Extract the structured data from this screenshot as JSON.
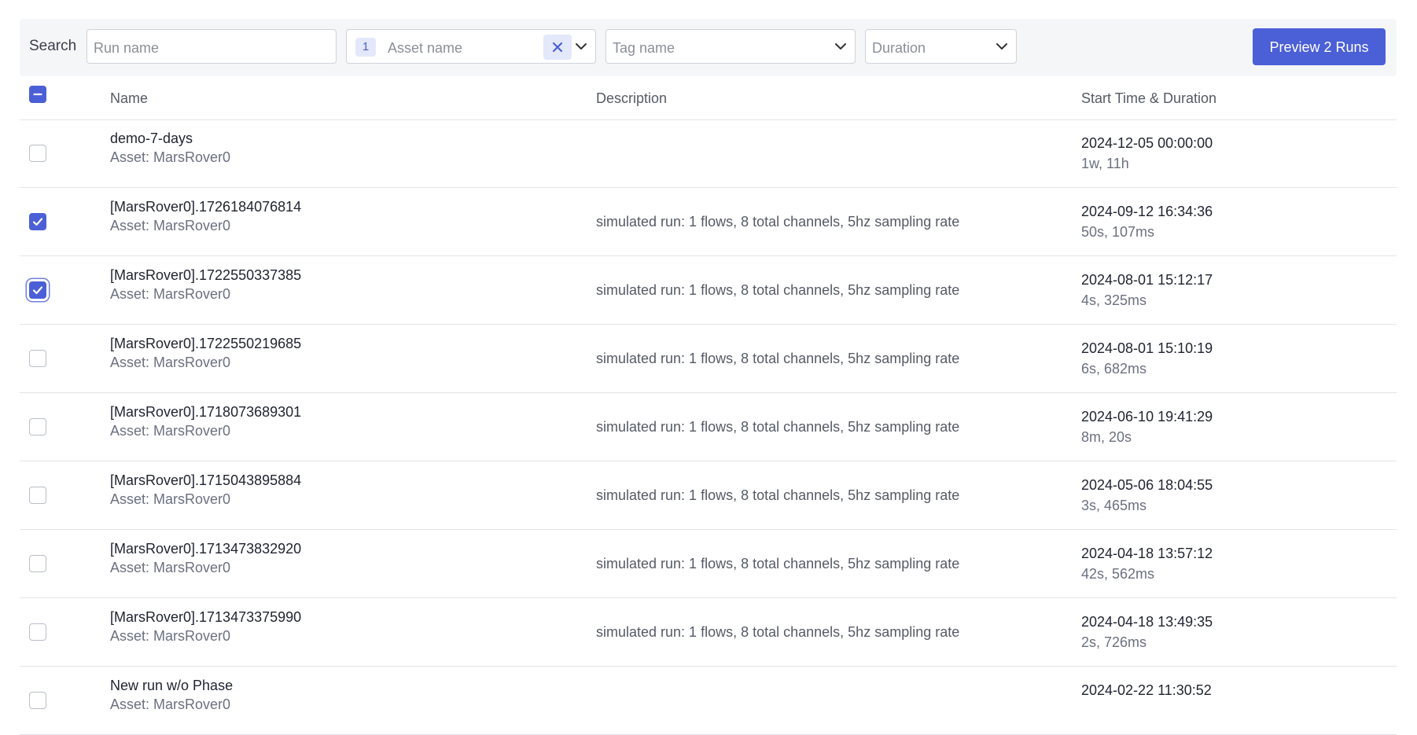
{
  "toolbar": {
    "search_label": "Search",
    "run_name_placeholder": "Run name",
    "asset_count": "1",
    "asset_placeholder": "Asset name",
    "tag_placeholder": "Tag name",
    "duration_placeholder": "Duration",
    "preview_label": "Preview 2 Runs"
  },
  "table": {
    "headers": {
      "name": "Name",
      "description": "Description",
      "start": "Start Time & Duration"
    },
    "select_all_state": "indeterminate",
    "rows": [
      {
        "name": "demo-7-days",
        "asset": "Asset: MarsRover0",
        "description": "",
        "start": "2024-12-05 00:00:00",
        "duration": "1w, 11h",
        "checked": false
      },
      {
        "name": "[MarsRover0].1726184076814",
        "asset": "Asset: MarsRover0",
        "description": "simulated run: 1 flows, 8 total channels, 5hz sampling rate",
        "start": "2024-09-12 16:34:36",
        "duration": "50s, 107ms",
        "checked": true
      },
      {
        "name": "[MarsRover0].1722550337385",
        "asset": "Asset: MarsRover0",
        "description": "simulated run: 1 flows, 8 total channels, 5hz sampling rate",
        "start": "2024-08-01 15:12:17",
        "duration": "4s, 325ms",
        "checked": true
      },
      {
        "name": "[MarsRover0].1722550219685",
        "asset": "Asset: MarsRover0",
        "description": "simulated run: 1 flows, 8 total channels, 5hz sampling rate",
        "start": "2024-08-01 15:10:19",
        "duration": "6s, 682ms",
        "checked": false
      },
      {
        "name": "[MarsRover0].1718073689301",
        "asset": "Asset: MarsRover0",
        "description": "simulated run: 1 flows, 8 total channels, 5hz sampling rate",
        "start": "2024-06-10 19:41:29",
        "duration": "8m, 20s",
        "checked": false
      },
      {
        "name": "[MarsRover0].1715043895884",
        "asset": "Asset: MarsRover0",
        "description": "simulated run: 1 flows, 8 total channels, 5hz sampling rate",
        "start": "2024-05-06 18:04:55",
        "duration": "3s, 465ms",
        "checked": false
      },
      {
        "name": "[MarsRover0].1713473832920",
        "asset": "Asset: MarsRover0",
        "description": "simulated run: 1 flows, 8 total channels, 5hz sampling rate",
        "start": "2024-04-18 13:57:12",
        "duration": "42s, 562ms",
        "checked": false
      },
      {
        "name": "[MarsRover0].1713473375990",
        "asset": "Asset: MarsRover0",
        "description": "simulated run: 1 flows, 8 total channels, 5hz sampling rate",
        "start": "2024-04-18 13:49:35",
        "duration": "2s, 726ms",
        "checked": false
      },
      {
        "name": "New run w/o Phase",
        "asset": "Asset: MarsRover0",
        "description": "",
        "start": "2024-02-22 11:30:52",
        "duration": "",
        "checked": false
      }
    ]
  },
  "colors": {
    "accent": "#4b5fd6",
    "badge_bg": "#e3e8fb",
    "toolbar_bg": "#f5f6f8"
  }
}
